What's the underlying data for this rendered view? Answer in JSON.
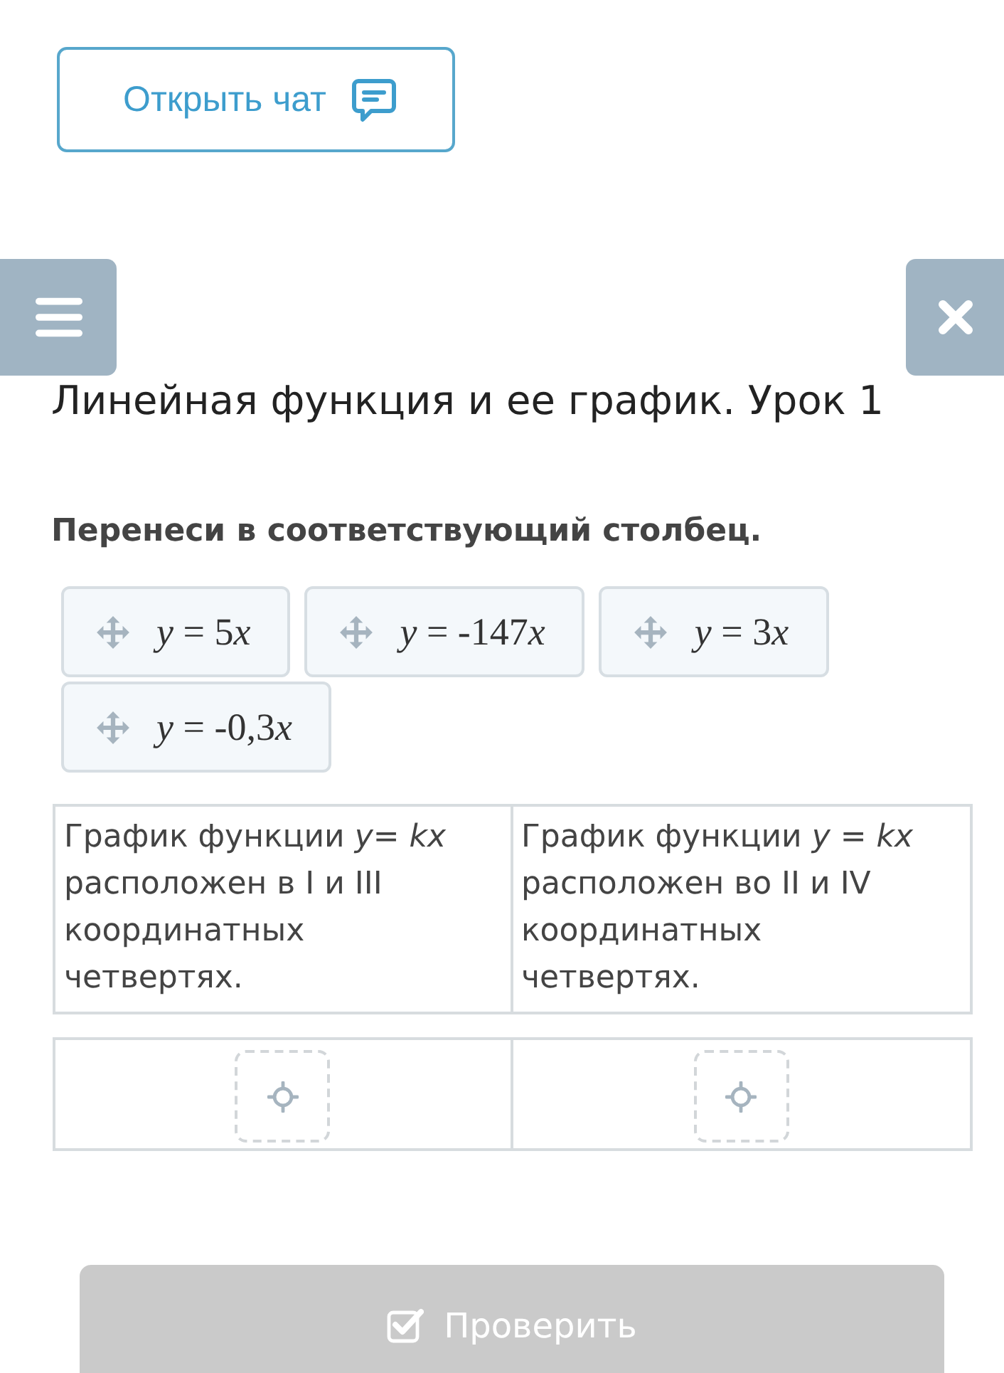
{
  "chat_button": {
    "label": "Открыть чат"
  },
  "lesson_title": "Линейная функция и ее график. Урок 1",
  "instruction": "Перенеси в соответствующий столбец.",
  "cards": [
    {
      "text": "y = 5x"
    },
    {
      "text": "y = -147x"
    },
    {
      "text": "y = 3x"
    },
    {
      "text": "y = -0,3x"
    }
  ],
  "columns": [
    {
      "heading": "График функции *y*= *kx* расположен в I и III координатных четвертях."
    },
    {
      "heading": "График функции *y* = *kx* расположен во II и IV координатных четвертях."
    }
  ],
  "check_button": {
    "label": "Проверить",
    "disabled": true
  }
}
